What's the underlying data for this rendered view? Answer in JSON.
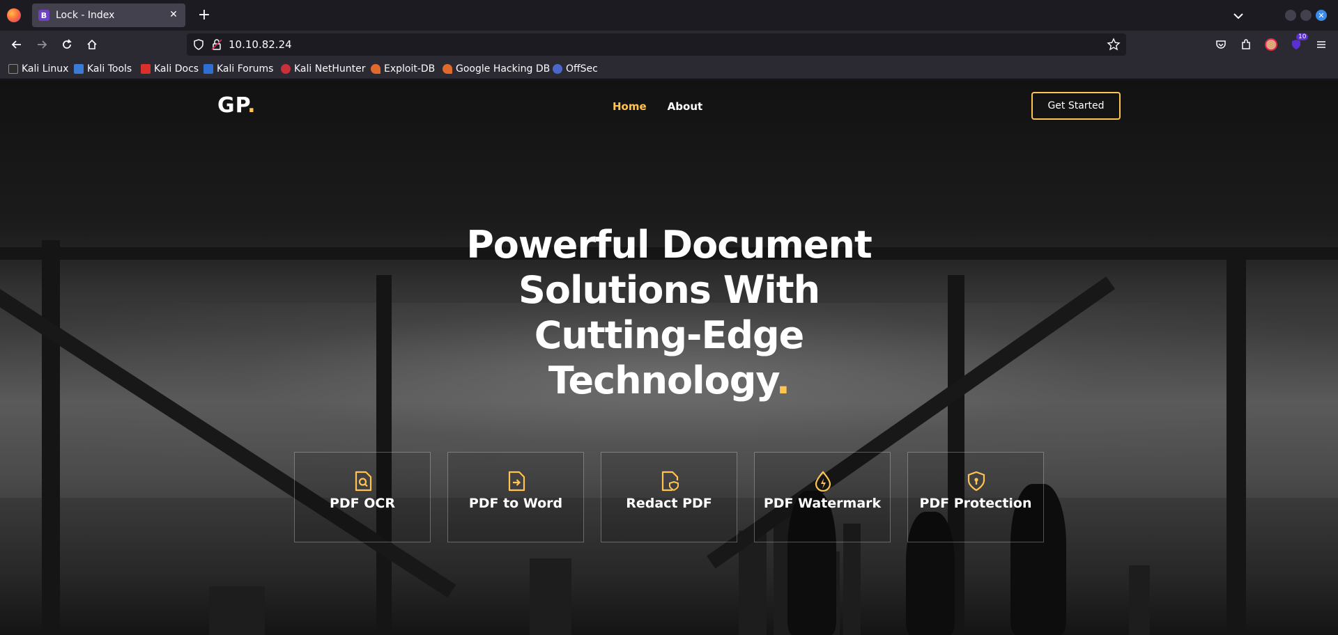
{
  "browser": {
    "tab_title": "Lock - Index",
    "tab_favicon_letter": "B",
    "url": "10.10.82.24",
    "extension_badge": "10",
    "bookmarks": [
      "Kali Linux",
      "Kali Tools",
      "Kali Docs",
      "Kali Forums",
      "Kali NetHunter",
      "Exploit-DB",
      "Google Hacking DB",
      "OffSec"
    ]
  },
  "site": {
    "logo_text": "GP",
    "logo_dot": ".",
    "nav": [
      "Home",
      "About"
    ],
    "cta_label": "Get Started",
    "hero_lines": [
      "Powerful Document",
      "Solutions With",
      "Cutting-Edge",
      "Technology"
    ],
    "hero_dot": ".",
    "features": [
      {
        "label": "PDF OCR",
        "icon": "file-search-icon"
      },
      {
        "label": "PDF to Word",
        "icon": "file-arrow-icon"
      },
      {
        "label": "Redact PDF",
        "icon": "file-shield-icon"
      },
      {
        "label": "PDF Watermark",
        "icon": "droplet-bolt-icon"
      },
      {
        "label": "PDF Protection",
        "icon": "shield-lock-icon"
      }
    ]
  },
  "colors": {
    "accent": "#ffc451",
    "chrome_dark": "#1c1b22",
    "chrome_mid": "#2b2a33"
  }
}
